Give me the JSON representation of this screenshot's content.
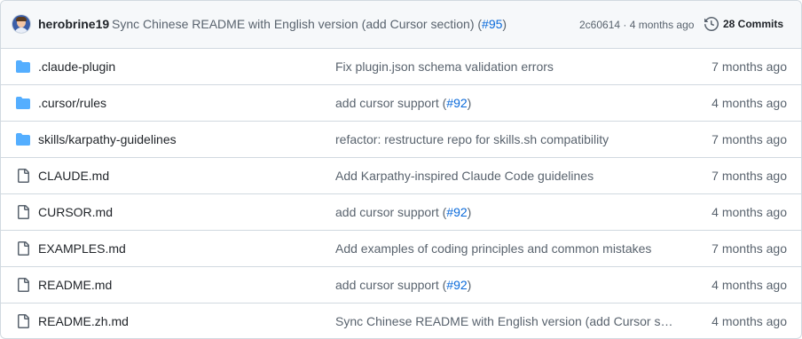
{
  "latest_commit": {
    "author": "herobrine19",
    "message_prefix": "Sync Chinese README with English version (add Cursor section) (",
    "pr_link": "#95",
    "message_suffix": ")",
    "hash": "2c60614",
    "separator": " · ",
    "time": "4 months ago",
    "commits_label": "28 Commits"
  },
  "colors": {
    "folder": "#54aeff",
    "file": "#59636e",
    "link": "#0969da"
  },
  "files": [
    {
      "type": "folder",
      "icon": "folder-icon",
      "name": ".claude-plugin",
      "msg": "Fix plugin.json schema validation errors",
      "pr": "",
      "msg_suffix": "",
      "date": "7 months ago"
    },
    {
      "type": "folder",
      "icon": "folder-icon",
      "name": ".cursor/rules",
      "msg": "add cursor support (",
      "pr": "#92",
      "msg_suffix": ")",
      "date": "4 months ago"
    },
    {
      "type": "folder",
      "icon": "folder-icon",
      "name": "skills/karpathy-guidelines",
      "msg": "refactor: restructure repo for skills.sh compatibility",
      "pr": "",
      "msg_suffix": "",
      "date": "7 months ago"
    },
    {
      "type": "file",
      "icon": "file-icon",
      "name": "CLAUDE.md",
      "msg": "Add Karpathy-inspired Claude Code guidelines",
      "pr": "",
      "msg_suffix": "",
      "date": "7 months ago"
    },
    {
      "type": "file",
      "icon": "file-icon",
      "name": "CURSOR.md",
      "msg": "add cursor support (",
      "pr": "#92",
      "msg_suffix": ")",
      "date": "4 months ago"
    },
    {
      "type": "file",
      "icon": "file-icon",
      "name": "EXAMPLES.md",
      "msg": "Add examples of coding principles and common mistakes",
      "pr": "",
      "msg_suffix": "",
      "date": "7 months ago"
    },
    {
      "type": "file",
      "icon": "file-icon",
      "name": "README.md",
      "msg": "add cursor support (",
      "pr": "#92",
      "msg_suffix": ")",
      "date": "4 months ago"
    },
    {
      "type": "file",
      "icon": "file-icon",
      "name": "README.zh.md",
      "msg": "Sync Chinese README with English version (add Cursor secti…",
      "pr": "",
      "msg_suffix": "",
      "date": "4 months ago"
    }
  ]
}
